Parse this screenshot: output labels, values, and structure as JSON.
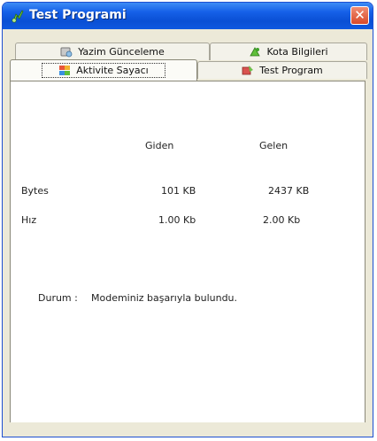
{
  "window": {
    "title": "Test Programi",
    "close_label": "✕"
  },
  "tabs": [
    {
      "label": "Yazim Günceleme",
      "icon": "update-icon"
    },
    {
      "label": "Kota Bilgileri",
      "icon": "quota-icon"
    },
    {
      "label": "Aktivite Sayacı",
      "icon": "activity-icon",
      "selected": true
    },
    {
      "label": "Test Program",
      "icon": "test-program-icon"
    }
  ],
  "stats": {
    "col_out": "Giden",
    "col_in": "Gelen",
    "rows": [
      {
        "label": "Bytes",
        "out": "101 KB",
        "in": "2437 KB"
      },
      {
        "label": "Hız",
        "out": "1.00 Kb",
        "in": "2.00 Kb"
      }
    ]
  },
  "status": {
    "label": "Durum :",
    "message": "Modeminiz başarıyla bulundu."
  }
}
